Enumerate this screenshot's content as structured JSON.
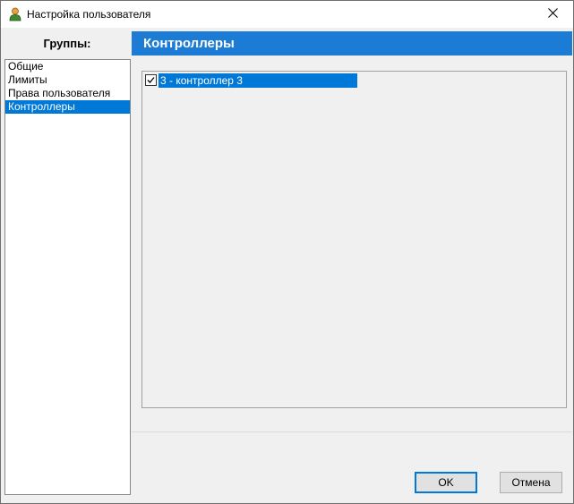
{
  "window": {
    "title": "Настройка пользователя",
    "app_icon": "user-icon",
    "close_icon": "close-icon"
  },
  "groups": {
    "header": "Группы:",
    "items": [
      {
        "label": "Общие",
        "selected": false
      },
      {
        "label": "Лимиты",
        "selected": false
      },
      {
        "label": "Права пользователя",
        "selected": false
      },
      {
        "label": "Контроллеры",
        "selected": true
      }
    ]
  },
  "section": {
    "title": "Контроллеры",
    "accent_color": "#1c7bd4"
  },
  "controllers": [
    {
      "label": "3 - контроллер 3",
      "checked": true
    }
  ],
  "buttons": {
    "ok": "OK",
    "cancel": "Отмена"
  },
  "colors": {
    "selection": "#0078d7",
    "window_bg": "#f0f0f0"
  }
}
